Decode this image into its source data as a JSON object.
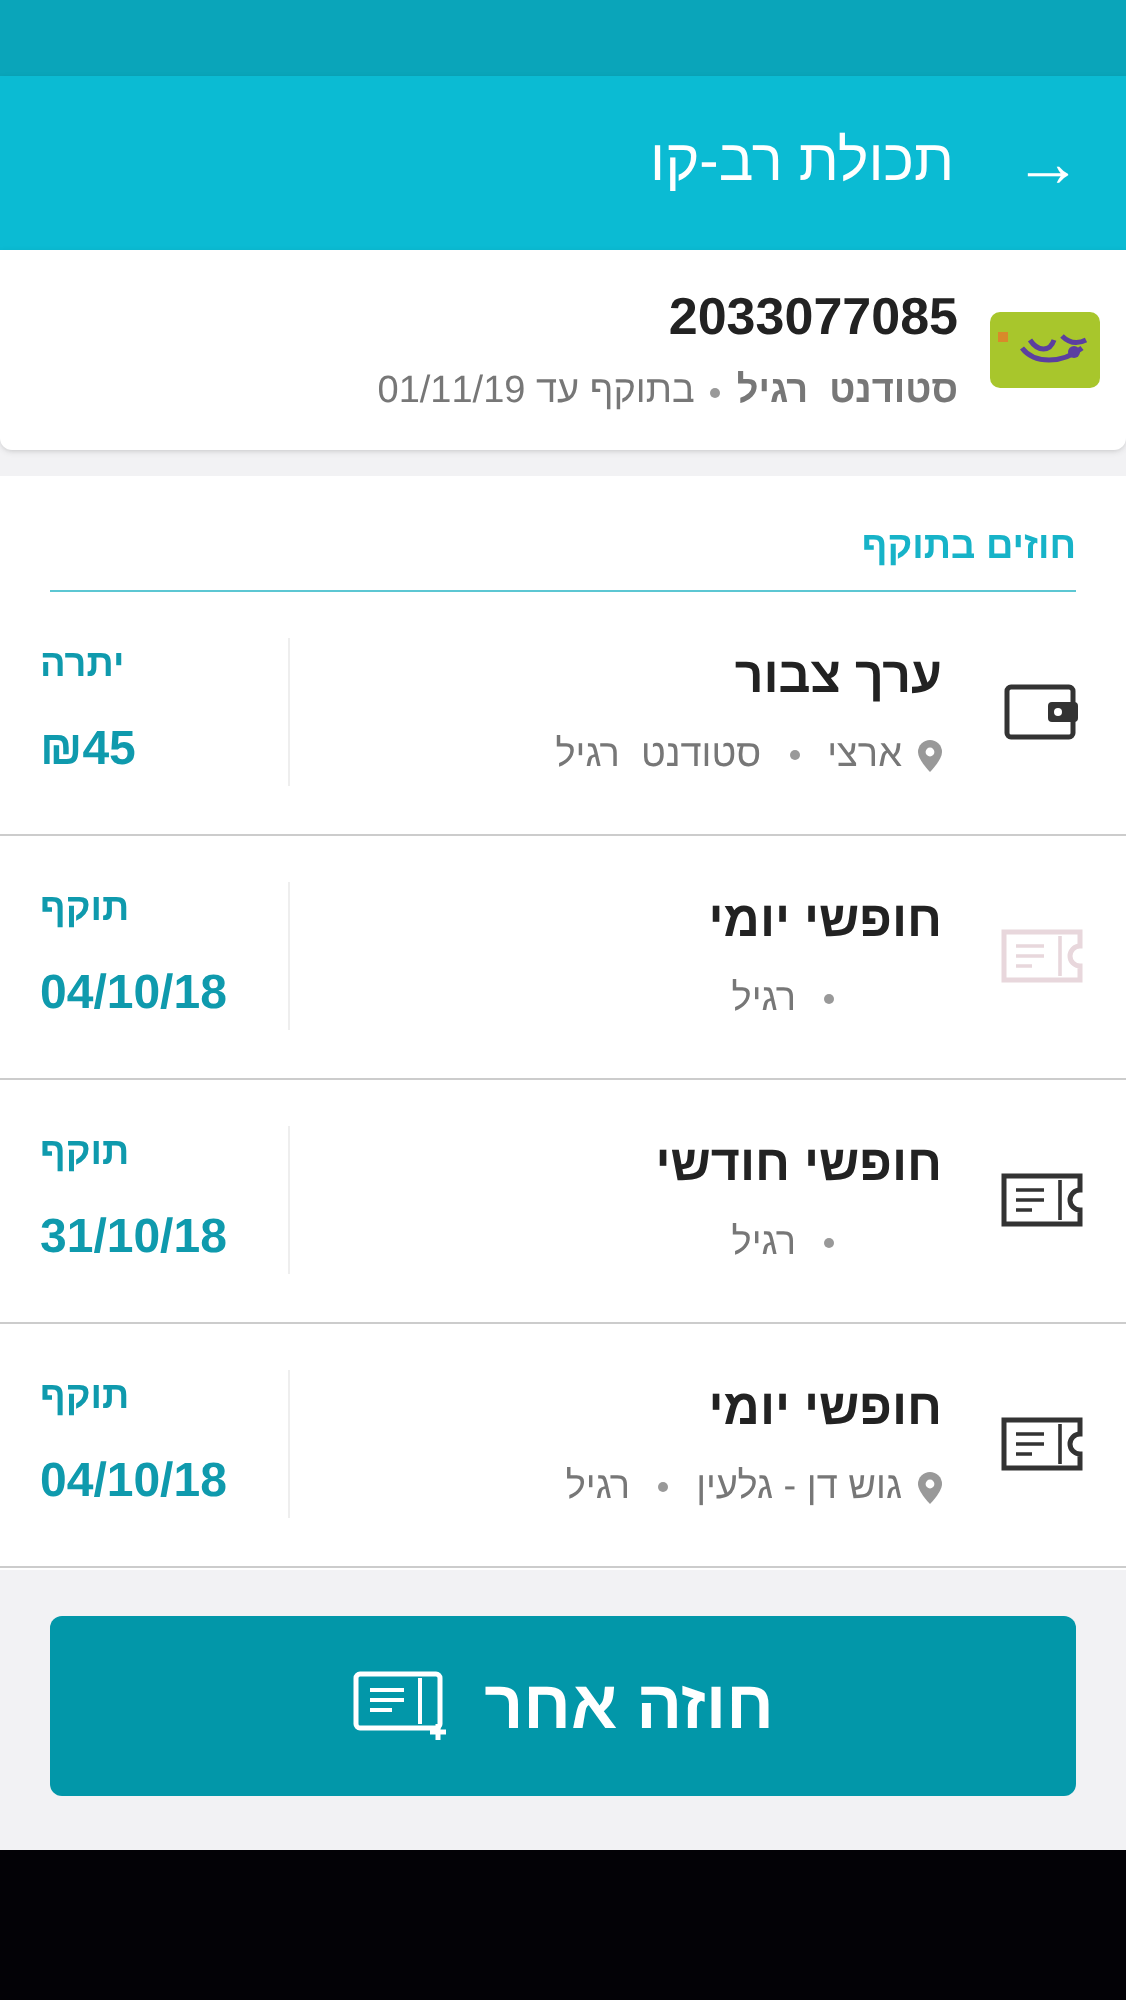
{
  "header": {
    "title": "תכולת רב-קו",
    "back_icon": "→"
  },
  "card": {
    "number": "2033077085",
    "profile": "סטודנט  רגיל",
    "validity": "בתוקף עד 01/11/19"
  },
  "section": {
    "title": "חוזים בתוקף"
  },
  "contracts": [
    {
      "kind": "wallet",
      "disabled": false,
      "name": "ערך צבור",
      "location": "ארצי",
      "profile": "סטודנט  רגיל",
      "label": "יתרה",
      "value": "₪45"
    },
    {
      "kind": "ticket",
      "disabled": true,
      "name": "חופשי יומי",
      "profile": "רגיל",
      "label": "תוקף",
      "value": "04/10/18"
    },
    {
      "kind": "ticket",
      "disabled": false,
      "name": "חופשי חודשי",
      "profile": "רגיל",
      "label": "תוקף",
      "value": "31/10/18"
    },
    {
      "kind": "ticket",
      "disabled": false,
      "name": "חופשי יומי",
      "location": "גוש דן - גלעין",
      "profile": "רגיל",
      "label": "תוקף",
      "value": "04/10/18"
    }
  ],
  "button": {
    "label": "חוזה אחר"
  }
}
